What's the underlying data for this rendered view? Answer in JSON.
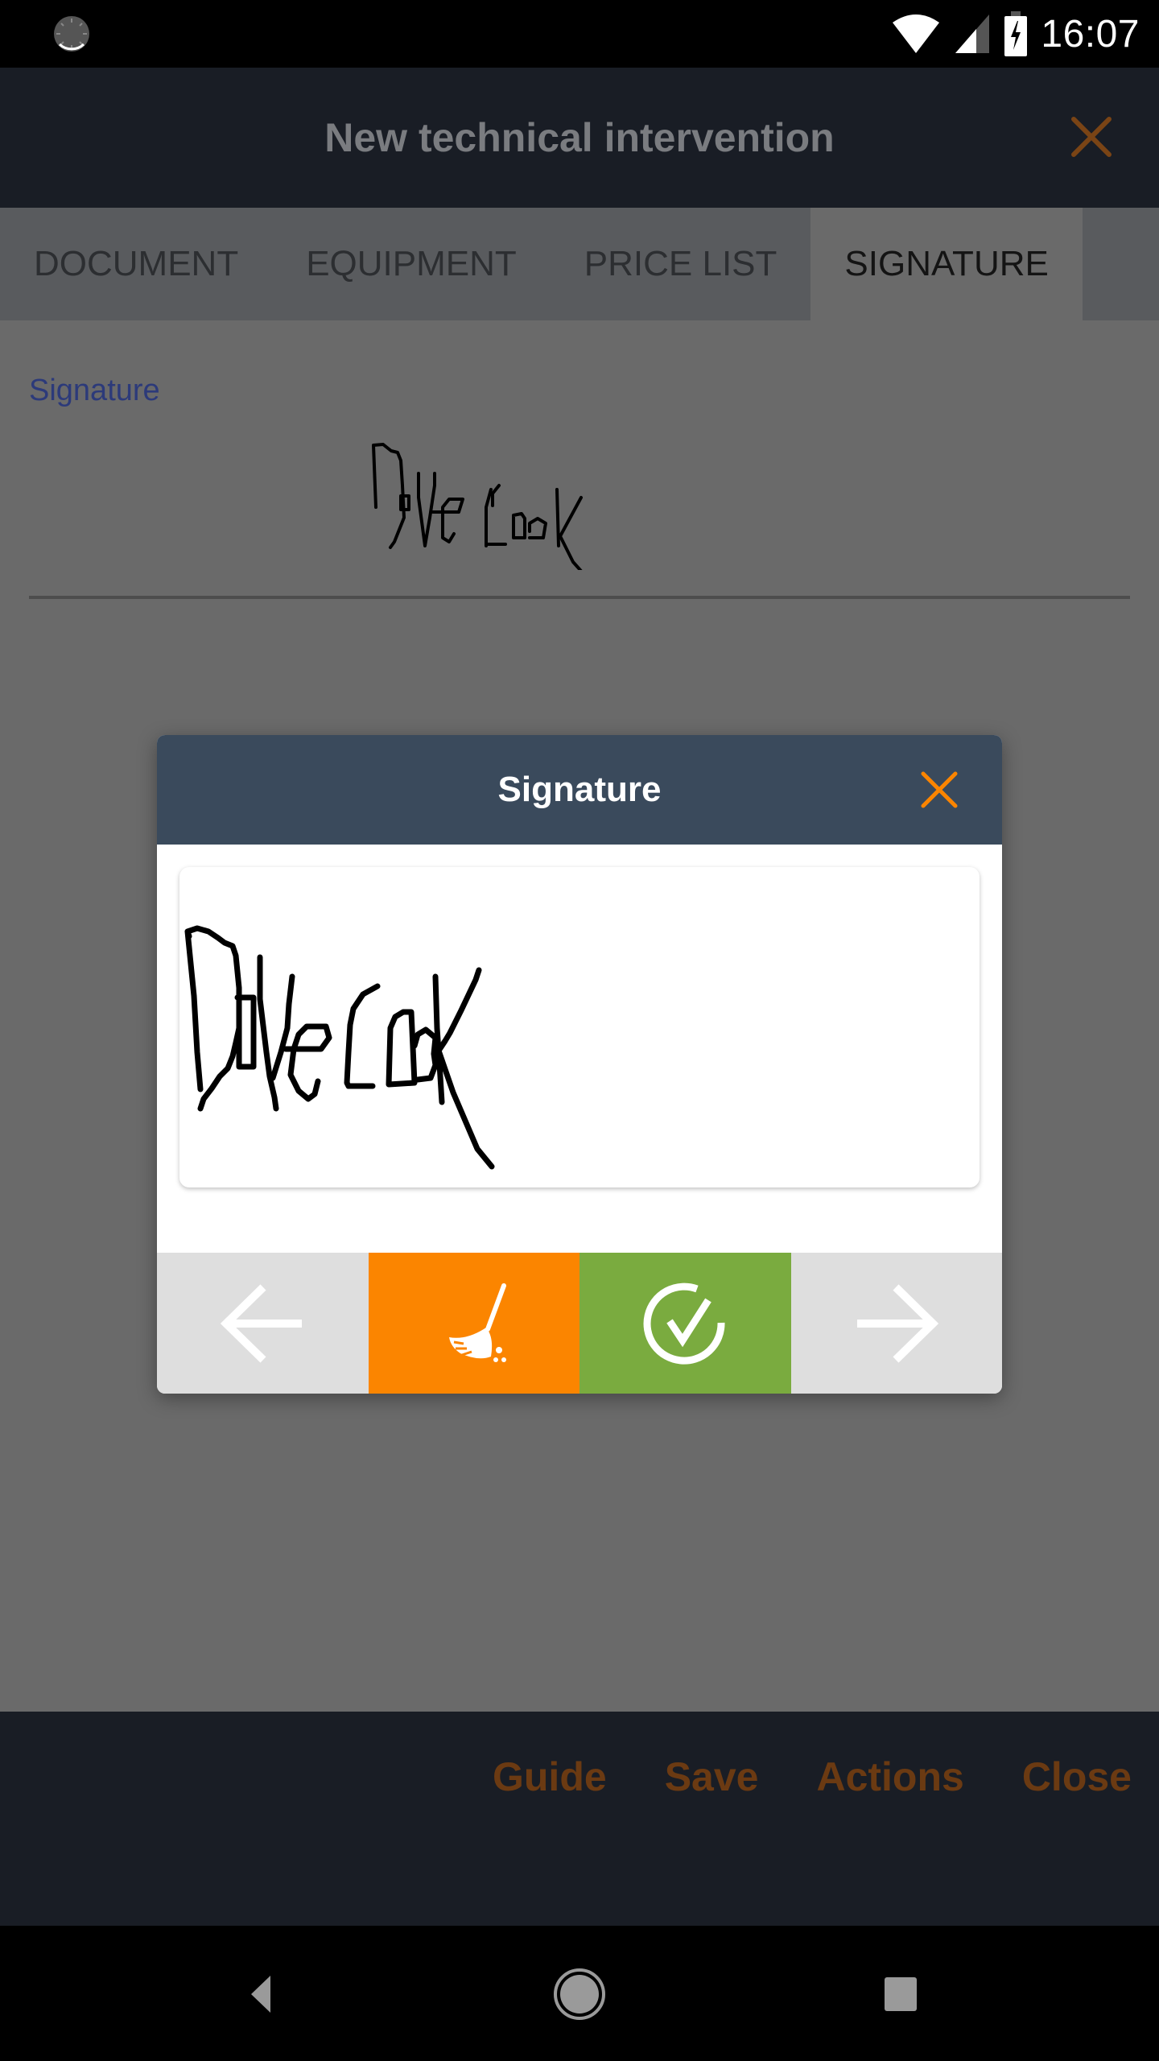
{
  "status_bar": {
    "time": "16:07",
    "icons": [
      "loading-spinner-icon",
      "wifi-icon",
      "cellular-signal-icon",
      "battery-charging-icon"
    ]
  },
  "header": {
    "title": "New technical intervention",
    "close_icon": "close-icon"
  },
  "tabs": [
    {
      "label": "DOCUMENT",
      "active": false
    },
    {
      "label": "EQUIPMENT",
      "active": false
    },
    {
      "label": "PRICE LIST",
      "active": false
    },
    {
      "label": "SIGNATURE",
      "active": true
    }
  ],
  "form": {
    "signature_label": "Signature",
    "signature_value": "Dave Cook (handwritten)"
  },
  "dialog": {
    "title": "Signature",
    "close_icon": "close-icon",
    "canvas_content": "Dave Cook (handwritten)",
    "actions": [
      {
        "name": "previous",
        "icon": "arrow-left-icon",
        "color": "#dedede"
      },
      {
        "name": "clear",
        "icon": "broom-icon",
        "color": "#fb8500"
      },
      {
        "name": "confirm",
        "icon": "check-circle-icon",
        "color": "#7aab3f"
      },
      {
        "name": "next",
        "icon": "arrow-right-icon",
        "color": "#dedede"
      }
    ]
  },
  "bottom_actions": [
    "Guide",
    "Save",
    "Actions",
    "Close"
  ],
  "colors": {
    "accent_orange": "#fb8500",
    "confirm_green": "#7aab3f",
    "dialog_header": "#3a4a5c",
    "app_bar": "#191d25",
    "label_blue": "#2c3a7a"
  },
  "nav_bar": [
    "back-icon",
    "home-icon",
    "recents-icon"
  ]
}
